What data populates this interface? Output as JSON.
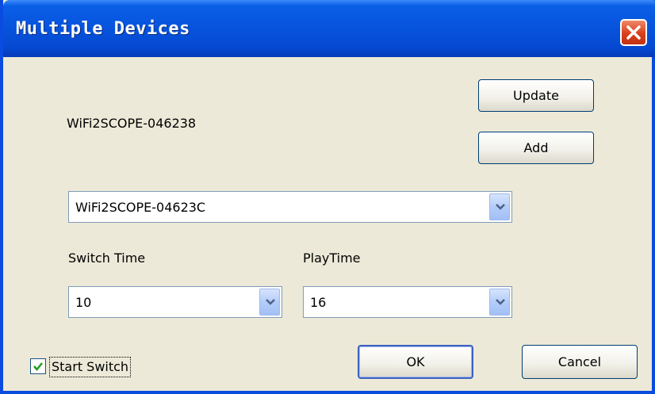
{
  "window": {
    "title": "Multiple Devices"
  },
  "device_label": "WiFi2SCOPE-046238",
  "buttons": {
    "update": "Update",
    "add": "Add",
    "ok": "OK",
    "cancel": "Cancel"
  },
  "device_select": {
    "value": "WiFi2SCOPE-04623C"
  },
  "switch_time": {
    "label": "Switch Time",
    "value": "10"
  },
  "play_time": {
    "label": "PlayTime",
    "value": "16"
  },
  "start_switch": {
    "label": "Start Switch",
    "checked": true
  },
  "colors": {
    "titlebar": "#0753dd",
    "face": "#ece9d8",
    "close": "#d8401c",
    "check": "#21a121"
  }
}
